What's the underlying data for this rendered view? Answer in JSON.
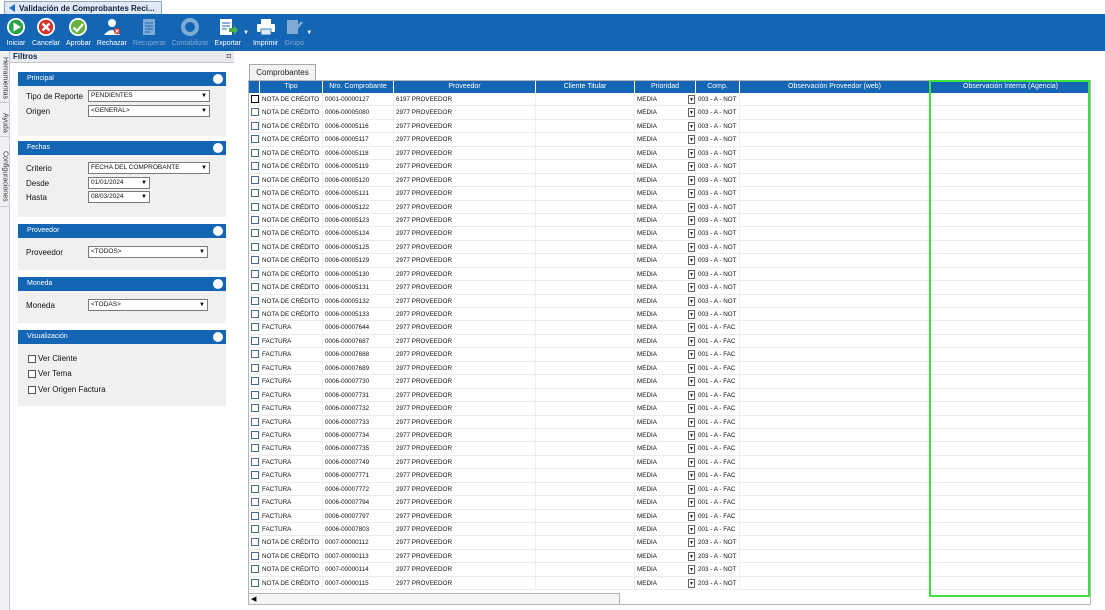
{
  "window": {
    "tab_title": "Validación de Comprobantes Reci..."
  },
  "toolbar": {
    "buttons": [
      {
        "label": "Iniciar",
        "icon": "play-icon",
        "disabled": false
      },
      {
        "label": "Cancelar",
        "icon": "cancel-icon",
        "disabled": false
      },
      {
        "label": "Aprobar",
        "icon": "approve-icon",
        "disabled": false
      },
      {
        "label": "Rechazar",
        "icon": "user-reject-icon",
        "disabled": false
      },
      {
        "label": "Recuperar",
        "icon": "document-icon",
        "disabled": true
      },
      {
        "label": "Contabilizar",
        "icon": "ledger-icon",
        "disabled": true
      },
      {
        "label": "Exportar",
        "icon": "export-icon",
        "disabled": false
      },
      {
        "label": "Imprimir",
        "icon": "printer-icon",
        "disabled": false
      },
      {
        "label": "Grupo",
        "icon": "group-icon",
        "disabled": true
      }
    ]
  },
  "side_tabs": [
    "Herramientas",
    "Ayuda",
    "Configuraciones"
  ],
  "filters": {
    "title": "Filtros",
    "principal": {
      "title": "Principal",
      "tipo_label": "Tipo de Reporte",
      "tipo_value": "PENDIENTES",
      "origen_label": "Origen",
      "origen_value": "<GENERAL>"
    },
    "fechas": {
      "title": "Fechas",
      "criterio_label": "Criterio",
      "criterio_value": "FECHA DEL COMPROBANTE",
      "desde_label": "Desde",
      "desde_value": "01/01/2024",
      "hasta_label": "Hasta",
      "hasta_value": "08/03/2024"
    },
    "proveedor": {
      "title": "Proveedor",
      "label": "Proveedor",
      "value": "<TODOS>"
    },
    "moneda": {
      "title": "Moneda",
      "label": "Moneda",
      "value": "<TODAS>"
    },
    "visualizacion": {
      "title": "Visualización",
      "options": [
        "Ver Cliente",
        "Ver Tema",
        "Ver Origen Factura"
      ]
    }
  },
  "main_tab": "Comprobantes",
  "grid": {
    "columns": [
      "Tipo",
      "Nro. Comprobante",
      "Proveedor",
      "Cliente Titular",
      "Prioridad",
      "Comp.",
      "Observación Proveedor (web)",
      "Observación Interna (Agencia)"
    ],
    "rows": [
      [
        "NOTA DE CRÉDITO",
        "0001-00000127",
        "6197 PROVEEDOR",
        "MEDIA",
        "003 - A - NOT"
      ],
      [
        "NOTA DE CRÉDITO",
        "0006-00005080",
        "2977 PROVEEDOR",
        "MEDIA",
        "003 - A - NOT"
      ],
      [
        "NOTA DE CRÉDITO",
        "0006-00005116",
        "2977 PROVEEDOR",
        "MEDIA",
        "003 - A - NOT"
      ],
      [
        "NOTA DE CRÉDITO",
        "0006-00005117",
        "2977 PROVEEDOR",
        "MEDIA",
        "003 - A - NOT"
      ],
      [
        "NOTA DE CRÉDITO",
        "0006-00005118",
        "2977 PROVEEDOR",
        "MEDIA",
        "003 - A - NOT"
      ],
      [
        "NOTA DE CRÉDITO",
        "0006-00005119",
        "2977 PROVEEDOR",
        "MEDIA",
        "003 - A - NOT"
      ],
      [
        "NOTA DE CRÉDITO",
        "0006-00005120",
        "2977 PROVEEDOR",
        "MEDIA",
        "003 - A - NOT"
      ],
      [
        "NOTA DE CRÉDITO",
        "0006-00005121",
        "2977 PROVEEDOR",
        "MEDIA",
        "003 - A - NOT"
      ],
      [
        "NOTA DE CRÉDITO",
        "0006-00005122",
        "2977 PROVEEDOR",
        "MEDIA",
        "003 - A - NOT"
      ],
      [
        "NOTA DE CRÉDITO",
        "0006-00005123",
        "2977 PROVEEDOR",
        "MEDIA",
        "003 - A - NOT"
      ],
      [
        "NOTA DE CRÉDITO",
        "0006-00005124",
        "2977 PROVEEDOR",
        "MEDIA",
        "003 - A - NOT"
      ],
      [
        "NOTA DE CRÉDITO",
        "0006-00005125",
        "2977 PROVEEDOR",
        "MEDIA",
        "003 - A - NOT"
      ],
      [
        "NOTA DE CRÉDITO",
        "0006-00005129",
        "2977 PROVEEDOR",
        "MEDIA",
        "003 - A - NOT"
      ],
      [
        "NOTA DE CRÉDITO",
        "0006-00005130",
        "2977 PROVEEDOR",
        "MEDIA",
        "003 - A - NOT"
      ],
      [
        "NOTA DE CRÉDITO",
        "0006-00005131",
        "2977 PROVEEDOR",
        "MEDIA",
        "003 - A - NOT"
      ],
      [
        "NOTA DE CRÉDITO",
        "0006-00005132",
        "2977 PROVEEDOR",
        "MEDIA",
        "003 - A - NOT"
      ],
      [
        "NOTA DE CRÉDITO",
        "0006-00005133",
        "2977 PROVEEDOR",
        "MEDIA",
        "003 - A - NOT"
      ],
      [
        "FACTURA",
        "0006-00007644",
        "2977 PROVEEDOR",
        "MEDIA",
        "001 - A - FAC"
      ],
      [
        "FACTURA",
        "0006-00007687",
        "2977 PROVEEDOR",
        "MEDIA",
        "001 - A - FAC"
      ],
      [
        "FACTURA",
        "0006-00007688",
        "2977 PROVEEDOR",
        "MEDIA",
        "001 - A - FAC"
      ],
      [
        "FACTURA",
        "0006-00007689",
        "2977 PROVEEDOR",
        "MEDIA",
        "001 - A - FAC"
      ],
      [
        "FACTURA",
        "0006-00007730",
        "2977 PROVEEDOR",
        "MEDIA",
        "001 - A - FAC"
      ],
      [
        "FACTURA",
        "0006-00007731",
        "2977 PROVEEDOR",
        "MEDIA",
        "001 - A - FAC"
      ],
      [
        "FACTURA",
        "0006-00007732",
        "2977 PROVEEDOR",
        "MEDIA",
        "001 - A - FAC"
      ],
      [
        "FACTURA",
        "0006-00007733",
        "2977 PROVEEDOR",
        "MEDIA",
        "001 - A - FAC"
      ],
      [
        "FACTURA",
        "0006-00007734",
        "2977 PROVEEDOR",
        "MEDIA",
        "001 - A - FAC"
      ],
      [
        "FACTURA",
        "0006-00007735",
        "2977 PROVEEDOR",
        "MEDIA",
        "001 - A - FAC"
      ],
      [
        "FACTURA",
        "0006-00007749",
        "2977 PROVEEDOR",
        "MEDIA",
        "001 - A - FAC"
      ],
      [
        "FACTURA",
        "0006-00007771",
        "2977 PROVEEDOR",
        "MEDIA",
        "001 - A - FAC"
      ],
      [
        "FACTURA",
        "0006-00007772",
        "2977 PROVEEDOR",
        "MEDIA",
        "001 - A - FAC"
      ],
      [
        "FACTURA",
        "0006-00007794",
        "2977 PROVEEDOR",
        "MEDIA",
        "001 - A - FAC"
      ],
      [
        "FACTURA",
        "0006-00007797",
        "2977 PROVEEDOR",
        "MEDIA",
        "001 - A - FAC"
      ],
      [
        "FACTURA",
        "0006-00007803",
        "2977 PROVEEDOR",
        "MEDIA",
        "001 - A - FAC"
      ],
      [
        "NOTA DE CRÉDITO",
        "0007-00000112",
        "2977 PROVEEDOR",
        "MEDIA",
        "203 - A - NOT"
      ],
      [
        "NOTA DE CRÉDITO",
        "0007-00000113",
        "2977 PROVEEDOR",
        "MEDIA",
        "203 - A - NOT"
      ],
      [
        "NOTA DE CRÉDITO",
        "0007-00000114",
        "2977 PROVEEDOR",
        "MEDIA",
        "203 - A - NOT"
      ],
      [
        "NOTA DE CRÉDITO",
        "0007-00000115",
        "2977 PROVEEDOR",
        "MEDIA",
        "203 - A - NOT"
      ]
    ]
  },
  "colors": {
    "accent": "#1466b4",
    "highlight": "#3ee13e"
  }
}
